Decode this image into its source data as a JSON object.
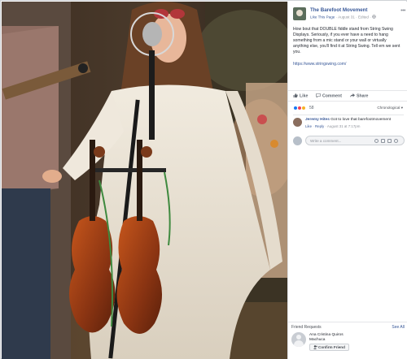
{
  "post": {
    "page_name": "The Barefoot Movement",
    "like_link": "Like This Page",
    "meta_sep": " · ",
    "date": "August 31",
    "edited": "· Edited ·",
    "text": "How bout that DOUBLE fiddle stand from String Swing Displays. Seriously, if you ever have a need to hang something from a mic stand or your wall or virtually anything else, you'll find it at String Swing. Tell em we sent you.",
    "link": "https://www.stringswing.com/"
  },
  "actions": {
    "like": "Like",
    "comment": "Comment",
    "share": "Share"
  },
  "reactions": {
    "count": "58",
    "sort": "Chronological ▾",
    "colors": {
      "like": "#1877f2",
      "love": "#f33e58",
      "haha": "#f7b125"
    }
  },
  "comment": {
    "author": "Jeremy Hites",
    "text": "Got to love that barefootmovement",
    "like": "Like",
    "reply": "Reply",
    "sep": " · ",
    "time": "August 31 at 7:17pm"
  },
  "composer": {
    "placeholder": "Write a comment..."
  },
  "friend_requests": {
    "title": "Friend Requests",
    "see_all": "See All",
    "name": "Ana Cristina Quiros Machuca",
    "confirm": "Confirm Friend"
  }
}
